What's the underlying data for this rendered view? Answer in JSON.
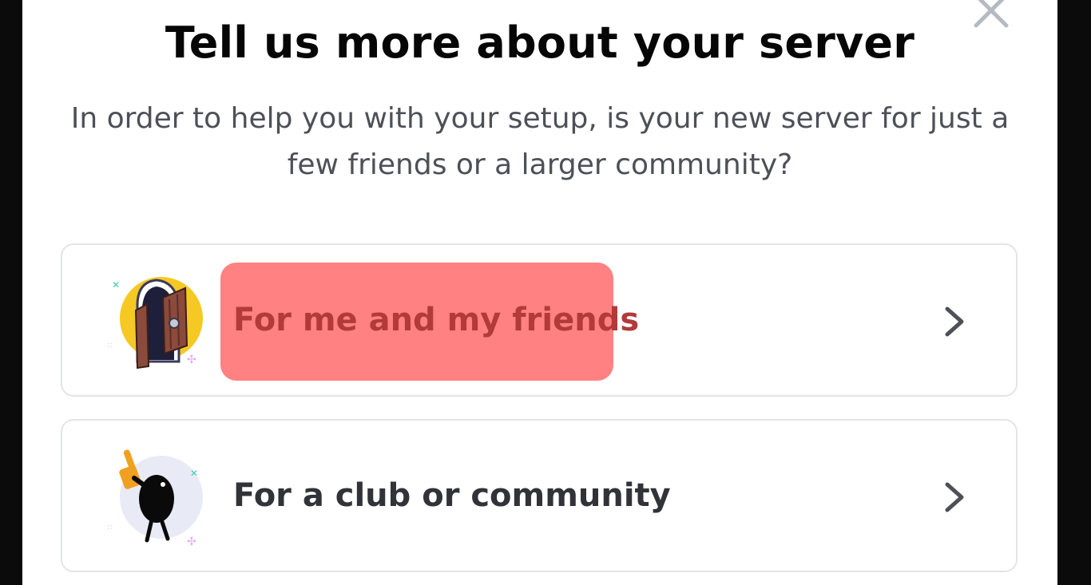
{
  "modal": {
    "title": "Tell us more about your server",
    "subtitle": "In order to help you with your setup, is your new server for just a few friends or a larger community?",
    "close_icon": "close-icon"
  },
  "options": [
    {
      "label": "For me and my friends",
      "icon": "door-illustration-icon",
      "chevron_icon": "chevron-right-icon",
      "highlighted": true,
      "highlight_color": "#ff7a7a"
    },
    {
      "label": "For a club or community",
      "icon": "cheering-character-icon",
      "chevron_icon": "chevron-right-icon",
      "highlighted": false
    }
  ],
  "colors": {
    "backdrop": "#000000",
    "modal_bg": "#ffffff",
    "title": "#060607",
    "subtitle": "#4e5058",
    "option_border": "#e3e5e8",
    "option_text": "#313338"
  }
}
